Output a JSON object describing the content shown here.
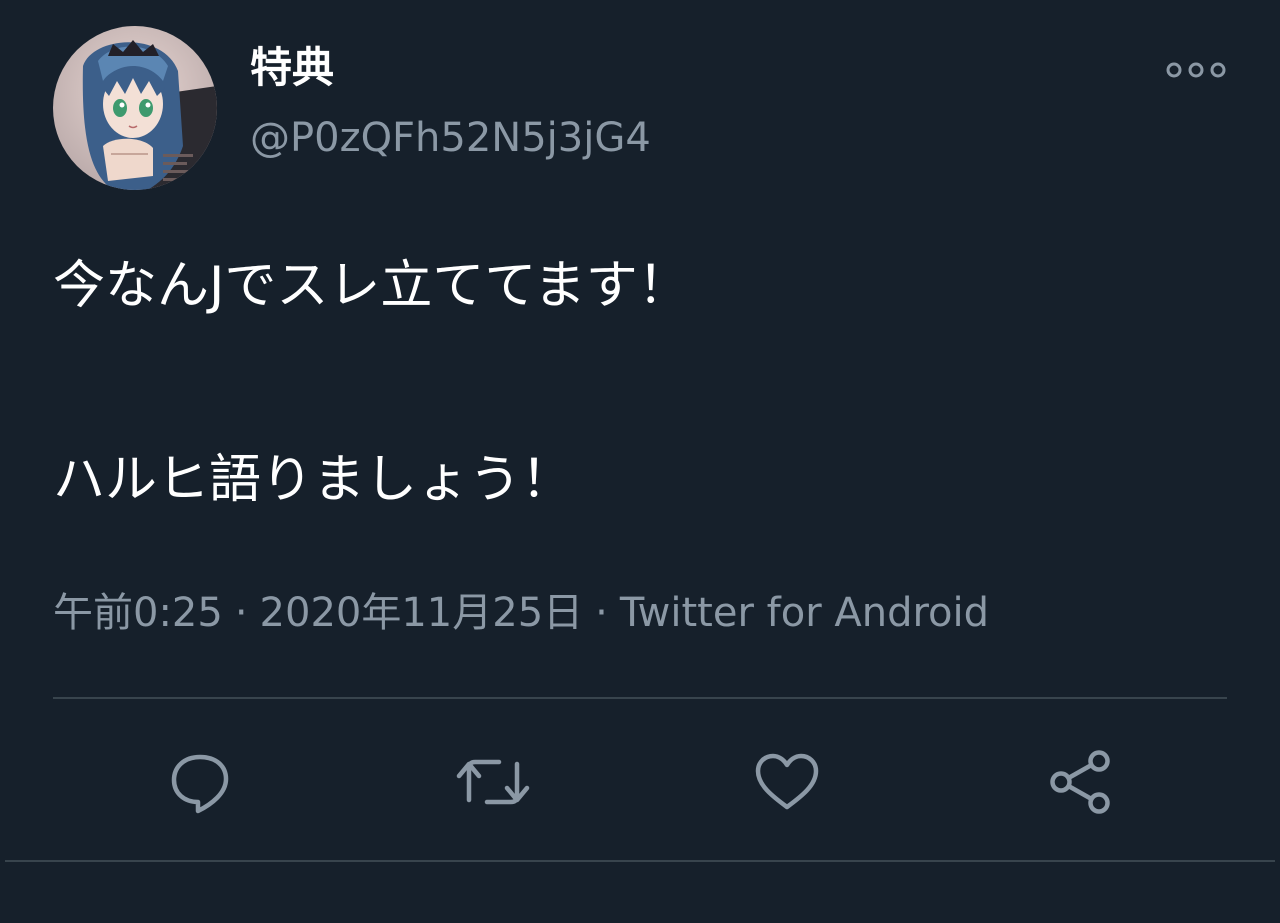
{
  "user": {
    "display_name": "特典",
    "handle": "@P0zQFh52N5j3jG4",
    "avatar_icon": "anime-character-avatar"
  },
  "header": {
    "more_icon": "more-options-icon"
  },
  "tweet": {
    "lines": [
      "今なんJでスレ立ててます！",
      "ハルヒ語りましょう！"
    ]
  },
  "meta": {
    "time": "午前0:25",
    "date": "2020年11月25日",
    "source": "Twitter for Android",
    "separator": "·"
  },
  "actions": [
    {
      "name": "reply",
      "icon": "reply-icon"
    },
    {
      "name": "retweet",
      "icon": "retweet-icon"
    },
    {
      "name": "like",
      "icon": "heart-icon"
    },
    {
      "name": "share",
      "icon": "share-icon"
    }
  ],
  "colors": {
    "background": "#16202b",
    "text_primary": "#ffffff",
    "text_secondary": "#8b98a5",
    "divider": "#38444d",
    "icon": "#8b98a5"
  }
}
